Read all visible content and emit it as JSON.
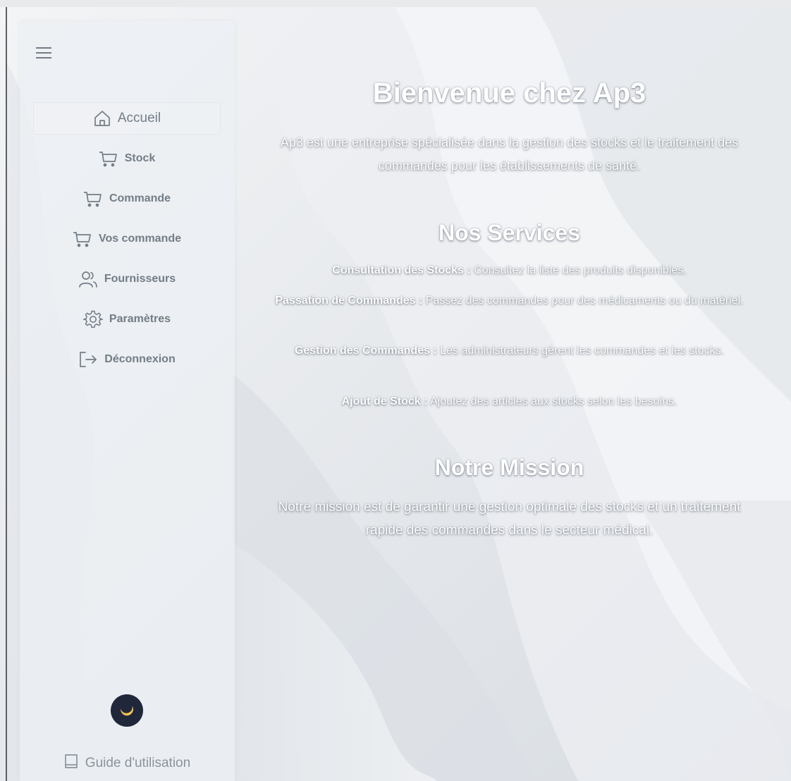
{
  "colors": {
    "sidebar_text": "#737d87",
    "toggle_bg": "#20273a",
    "toggle_icon": "#f3c34b",
    "heading_text": "#ffffff"
  },
  "sidebar": {
    "menu_icon": "hamburger-icon",
    "items": [
      {
        "label": "Accueil",
        "icon": "home-icon",
        "active": true
      },
      {
        "label": "Stock",
        "icon": "cart-icon"
      },
      {
        "label": "Commande",
        "icon": "cart-icon"
      },
      {
        "label": "Vos commande",
        "icon": "cart-icon"
      },
      {
        "label": "Fournisseurs",
        "icon": "users-icon"
      },
      {
        "label": "Paramètres",
        "icon": "gear-icon"
      },
      {
        "label": "Déconnexion",
        "icon": "logout-icon"
      }
    ],
    "theme_toggle_icon": "moon-icon",
    "guide": {
      "label": "Guide d'utilisation",
      "icon": "book-icon"
    }
  },
  "main": {
    "title": "Bienvenue chez Ap3",
    "intro": "Ap3 est une entreprise spécialisée dans la gestion des stocks et le traitement des commandes pour les établissements de santé.",
    "services_title": "Nos Services",
    "services": [
      {
        "name": "Consultation des Stocks :",
        "desc": "Consultez la liste des produits disponibles."
      },
      {
        "name": "Passation de Commandes :",
        "desc": "Passez des commandes pour des médicaments ou du matériel."
      },
      {
        "name": "Gestion des Commandes :",
        "desc": "Les administrateurs gèrent les commandes et les stocks."
      },
      {
        "name": "Ajout de Stock :",
        "desc": "Ajoutez des articles aux stocks selon les besoins."
      }
    ],
    "mission_title": "Notre Mission",
    "mission_text": "Notre mission est de garantir une gestion optimale des stocks et un traitement rapide des commandes dans le secteur médical."
  }
}
